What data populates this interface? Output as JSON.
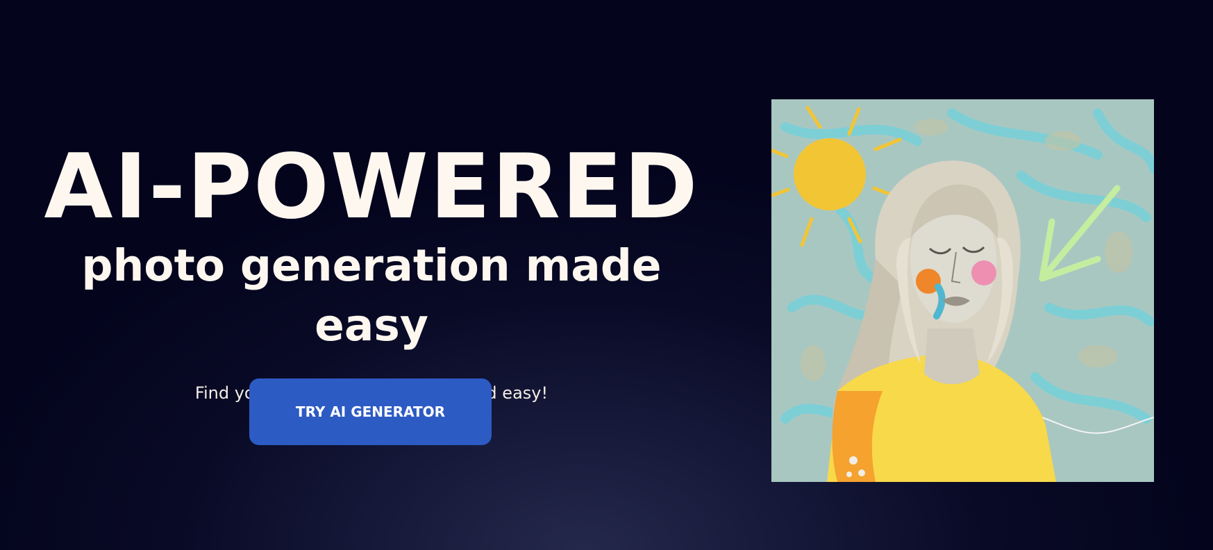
{
  "hero": {
    "headline": "AI-POWERED",
    "subheadline": "photo generation made easy",
    "tagline": "Find your style with our AI - fast and easy!",
    "cta_label": "TRY AI GENERATOR"
  },
  "artwork": {
    "alt": "Illustrated portrait of a woman in a yellow sweater with a sun and arrow"
  },
  "colors": {
    "background": "#06061f",
    "text": "#fdf7ef",
    "cta": "#2d5bc4",
    "sun": "#f2c535",
    "sweater": "#f8d94a",
    "arrow": "#c5eda0"
  }
}
